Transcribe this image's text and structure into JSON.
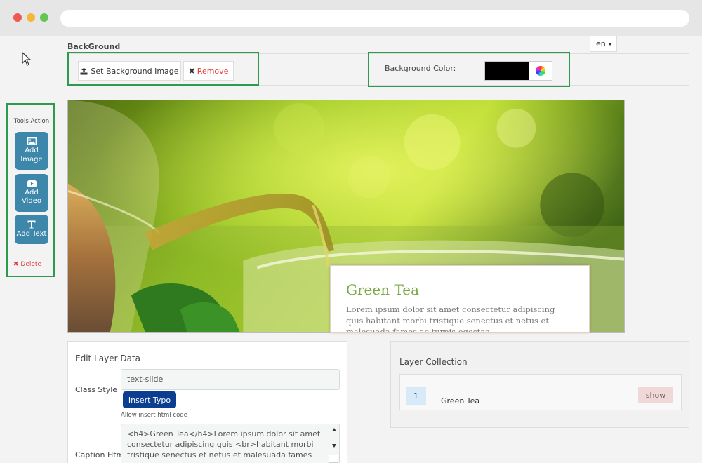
{
  "language": {
    "selected": "en"
  },
  "background_section": {
    "title": "BackGround",
    "set_image_label": "Set Background Image",
    "remove_label": "Remove",
    "color_label": "Background Color:",
    "color_value": "#000000"
  },
  "tools": {
    "title": "Tools Action",
    "add_image": [
      "Add",
      "Image"
    ],
    "add_video": [
      "Add",
      "Video"
    ],
    "add_text": "Add Text",
    "delete": "Delete"
  },
  "slide": {
    "caption_title": "Green Tea",
    "caption_text": "Lorem ipsum dolor sit amet consectetur adipiscing quis habitant morbi tristique senectus et netus et malesuada fames ac turpis egestas"
  },
  "edit_layer": {
    "title": "Edit Layer Data",
    "class_style_label": "Class Style",
    "class_style_value": "text-slide",
    "insert_typo_label": "Insert Typo",
    "allow_hint": "Allow insert html code",
    "caption_label": "Caption Html",
    "caption_value": "<h4>Green Tea</h4>Lorem ipsum dolor sit amet consectetur adipiscing quis <br>habitant morbi tristique senectus et netus et malesuada fames"
  },
  "layer_collection": {
    "title": "Layer Collection",
    "items": [
      {
        "index": "1",
        "name": "Green Tea",
        "action": "show"
      }
    ]
  },
  "colors": {
    "accent_blue": "#3d87ab",
    "typo_button": "#0b3d91",
    "highlight_green": "#2e9a4e",
    "remove_red": "#e03a3a",
    "caption_green": "#7aa844"
  }
}
